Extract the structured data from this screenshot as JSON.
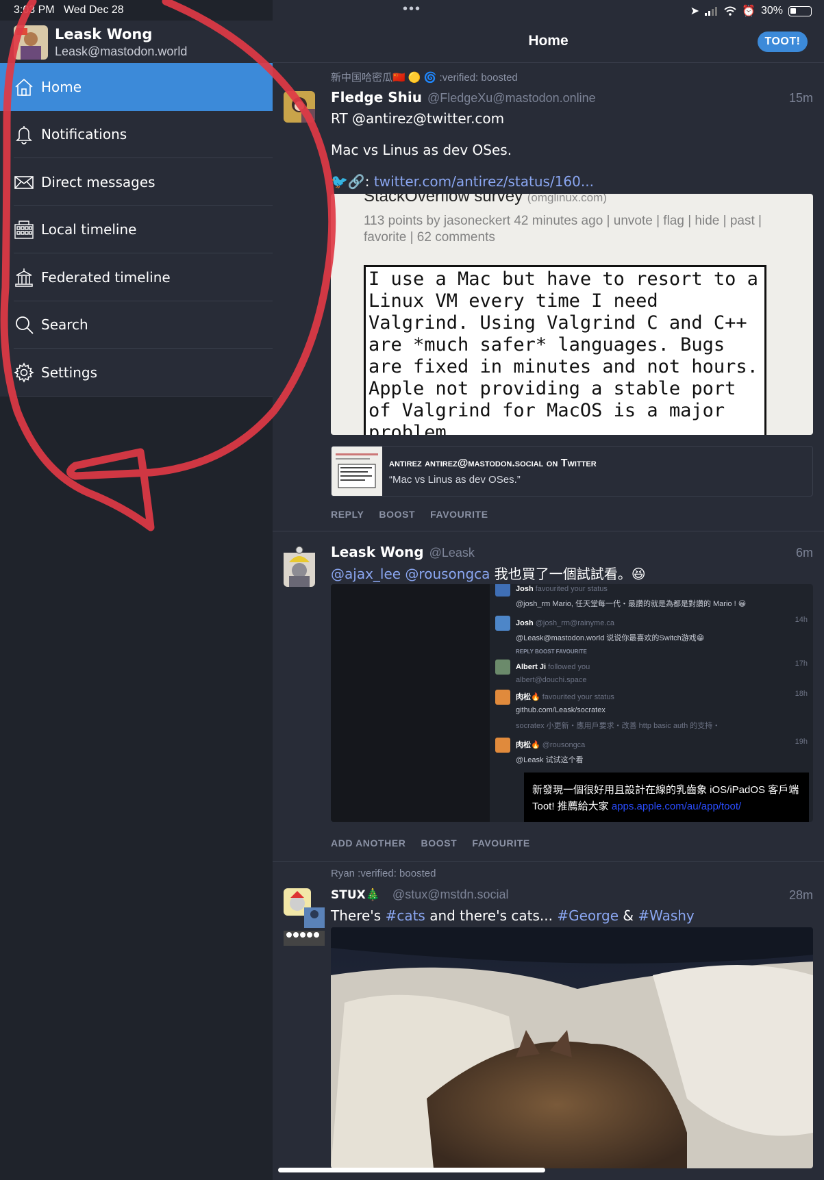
{
  "status_bar": {
    "time": "3:03 PM",
    "date": "Wed Dec 28",
    "dots": "•••",
    "battery": "30%",
    "battery_level": 0.3
  },
  "profile": {
    "name": "Leask Wong",
    "acct": "Leask@mastodon.world"
  },
  "nav": [
    {
      "label": "Home",
      "icon": "home-icon",
      "active": true
    },
    {
      "label": "Notifications",
      "icon": "bell-icon"
    },
    {
      "label": "Direct messages",
      "icon": "envelope-icon"
    },
    {
      "label": "Local timeline",
      "icon": "building-icon"
    },
    {
      "label": "Federated timeline",
      "icon": "bank-icon"
    },
    {
      "label": "Search",
      "icon": "search-icon"
    },
    {
      "label": "Settings",
      "icon": "gear-icon"
    }
  ],
  "header": {
    "title": "Home",
    "toot_button": "TOOT!"
  },
  "colors": {
    "accent": "#3c8ad9",
    "bg": "#282c37",
    "sidebar": "#1f232b",
    "muted": "#8c93a6",
    "link": "#8aa6f1",
    "annotation": "#e03a45"
  },
  "statuses": [
    {
      "boosted_by": "新中国哈密瓜🇨🇳 🟡 🌀 :verified: boosted",
      "name": "Fledge Shiu",
      "acct": "@FledgeXu@mastodon.online",
      "time": "15m",
      "text1": "RT @antirez@twitter.com",
      "text2": "Mac vs Linus as dev OSes.",
      "text3_prefix": "🐦🔗: ",
      "text3_link": "twitter.com/antirez/status/160...",
      "image": {
        "title": "StackOverflow survey",
        "domain": "(omglinux.com)",
        "meta": "113 points by jasoneckert 42 minutes ago | unvote | flag | hide | past | favorite | 62 comments",
        "quote": "I use a Mac but have to resort to a\nLinux VM every time I need\nValgrind. Using Valgrind C and C++\nare *much safer* languages. Bugs\nare fixed in minutes and not hours.\nApple not providing a stable port\nof Valgrind for MacOS is a major\nproblem."
      },
      "card": {
        "title": "antirez antirez@mastodon.social on Twitter",
        "desc": "“Mac vs Linus as dev OSes.”"
      },
      "actions": [
        "REPLY",
        "BOOST",
        "FAVOURITE"
      ]
    },
    {
      "name": "Leask Wong",
      "acct": "@Leask",
      "time": "6m",
      "text_link": "@ajax_lee @rousongca",
      "text": " 我也買了一個試試看。😆",
      "notifications": [
        {
          "name": "Josh",
          "sub": "favourited your status",
          "body": "@josh_rm Mario, 任天堂每一代・最讚的就是為都是對讚的 Mario ! 😀"
        },
        {
          "name": "Josh",
          "sub": "@josh_rm@rainyme.ca",
          "body": "@Leask@mastodon.world 说说你最喜欢的Switch游戏😁",
          "time": "14h"
        },
        {
          "name": "Albert Ji",
          "sub": "followed you",
          "body": "albert@douchi.space",
          "time": "17h"
        },
        {
          "name": "肉松🔥",
          "sub": "favourited your status",
          "body": "github.com/Leask/socratex",
          "time": "18h"
        },
        {
          "name": "肉松🔥",
          "sub": "@rousongca",
          "body": "@Leask 试试这个看",
          "time": "19h"
        }
      ],
      "mini_actions": "REPLY   BOOST   FAVOURITE",
      "footer_note": "socratex 小更新・應用戶要求・改善 http basic auth 的支持・",
      "promo_text": "新發現一個很好用且設計在線的乳齒象 iOS/iPadOS 客戶端 Toot! 推薦給大家 ",
      "promo_link": "apps.apple.com/au/app/toot/",
      "actions": [
        "ADD ANOTHER",
        "BOOST",
        "FAVOURITE"
      ]
    },
    {
      "boosted_by": "Ryan :verified: boosted",
      "name": "STUX🎄",
      "acct": "@stux@mstdn.social",
      "time": "28m",
      "text_a": "There's ",
      "tag1": "#cats",
      "text_b": " and there's cats... ",
      "tag2": "#George",
      "text_c": " & ",
      "tag3": "#Washy"
    }
  ]
}
